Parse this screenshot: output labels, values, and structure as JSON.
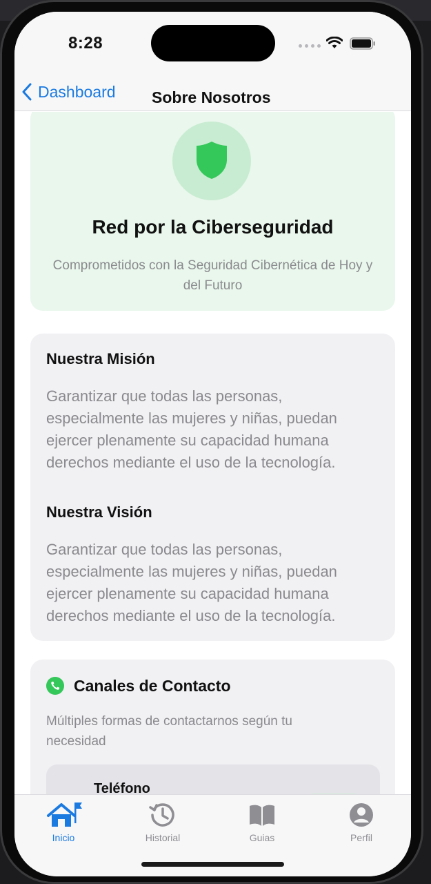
{
  "status_bar": {
    "time": "8:28"
  },
  "nav": {
    "back_label": "Dashboard",
    "title": "Sobre Nosotros"
  },
  "hero": {
    "icon": "shield-icon",
    "title": "Red por la Ciberseguridad",
    "subtitle": "Comprometidos con la Seguridad Cibernética de Hoy y del Futuro"
  },
  "mission": {
    "title": "Nuestra Misión",
    "text": "Garantizar que todas las personas, especialmente las mujeres y niñas, puedan ejercer plenamente su capacidad humana derechos mediante el uso de la tecnología."
  },
  "vision": {
    "title": "Nuestra Visión",
    "text": "Garantizar que todas las personas, especialmente las mujeres y niñas, puedan ejercer plenamente su capacidad humana derechos mediante el uso de la tecnología."
  },
  "contact": {
    "icon": "phone-icon",
    "title": "Canales de Contacto",
    "description": "Múltiples formas de contactarnos según tu necesidad",
    "items": [
      {
        "label": "Teléfono"
      }
    ]
  },
  "tabs": [
    {
      "label": "Inicio",
      "icon": "home-icon",
      "active": true
    },
    {
      "label": "Historial",
      "icon": "history-icon",
      "active": false
    },
    {
      "label": "Guias",
      "icon": "book-icon",
      "active": false
    },
    {
      "label": "Perfil",
      "icon": "profile-icon",
      "active": false
    }
  ],
  "colors": {
    "accent": "#1a7ae0",
    "green": "#34c759",
    "hero_bg": "#e9f7ec",
    "card_bg": "#f1f1f4"
  }
}
